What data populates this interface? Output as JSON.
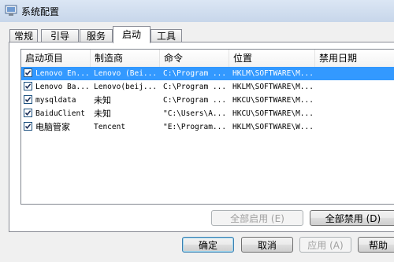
{
  "window": {
    "title": "系统配置"
  },
  "tabs": [
    {
      "label": "常规"
    },
    {
      "label": "引导"
    },
    {
      "label": "服务"
    },
    {
      "label": "启动"
    },
    {
      "label": "工具"
    }
  ],
  "startup_list": {
    "columns": [
      "启动项目",
      "制造商",
      "命令",
      "位置",
      "禁用日期"
    ],
    "rows": [
      {
        "checked": true,
        "item": "Lenovo En...",
        "manufacturer": "Lenovo (Bei...",
        "command": "C:\\Program ...",
        "location": "HKLM\\SOFTWARE\\M...",
        "disabled_date": ""
      },
      {
        "checked": true,
        "item": "Lenovo Ba...",
        "manufacturer": "Lenovo(beij...",
        "command": "C:\\Program ...",
        "location": "HKLM\\SOFTWARE\\M...",
        "disabled_date": ""
      },
      {
        "checked": true,
        "item": "mysqldata",
        "manufacturer": "未知",
        "command": "C:\\Program ...",
        "location": "HKCU\\SOFTWARE\\M...",
        "disabled_date": ""
      },
      {
        "checked": true,
        "item": "BaiduClient",
        "manufacturer": "未知",
        "command": "\"C:\\Users\\A...",
        "location": "HKCU\\SOFTWARE\\M...",
        "disabled_date": ""
      },
      {
        "checked": true,
        "item": "电脑管家",
        "manufacturer": "Tencent",
        "command": "\"E:\\Program...",
        "location": "HKLM\\SOFTWARE\\W...",
        "disabled_date": ""
      }
    ]
  },
  "buttons": {
    "enable_all": "全部启用 (E)",
    "disable_all": "全部禁用 (D)",
    "ok": "确定",
    "cancel": "取消",
    "apply": "应用 (A)",
    "help": "帮助"
  },
  "colors": {
    "selection": "#3399ff",
    "window_bg": "#f0f0f0"
  }
}
